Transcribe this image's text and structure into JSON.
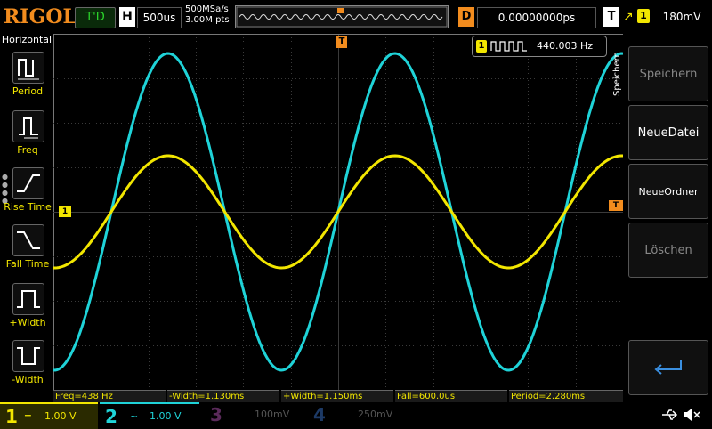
{
  "brand": "RIGOL",
  "top": {
    "run_state": "T'D",
    "timebase_label": "H",
    "timebase_value": "500us",
    "sample_rate": "500MSa/s",
    "memory_depth": "3.00M pts",
    "delay_label": "D",
    "delay_value": "0.00000000ps",
    "trigger_label": "T",
    "trigger_channel": "1",
    "trigger_level": "180mV"
  },
  "left_panel": {
    "title": "Horizontal",
    "items": [
      {
        "label": "Period",
        "icon": "period-icon"
      },
      {
        "label": "Freq",
        "icon": "freq-icon"
      },
      {
        "label": "Rise Time",
        "icon": "rise-time-icon"
      },
      {
        "label": "Fall Time",
        "icon": "fall-time-icon"
      },
      {
        "label": "+Width",
        "icon": "pos-width-icon"
      },
      {
        "label": "-Width",
        "icon": "neg-width-icon"
      }
    ]
  },
  "right_panel": {
    "tab": "Speichern",
    "buttons": [
      {
        "label": "Speichern",
        "enabled": false
      },
      {
        "label": "NeueDatei",
        "enabled": true
      },
      {
        "label": "NeueOrdner",
        "enabled": true
      },
      {
        "label": "Löschen",
        "enabled": false
      },
      {
        "label": "",
        "icon": "return-arrow-icon",
        "enabled": true
      }
    ]
  },
  "freq_counter": {
    "channel": "1",
    "value": "440.003 Hz"
  },
  "markers": {
    "trigger_position": "T",
    "ch1_ground": "1",
    "trigger_level": "T"
  },
  "measurements": [
    "Freq=438 Hz",
    "-Width=1.130ms",
    "+Width=1.150ms",
    "Fall=600.0us",
    "Period=2.280ms"
  ],
  "channels": [
    {
      "num": "1",
      "coupling": "DC",
      "scale": "1.00 V",
      "color": "#f2e600",
      "active": true
    },
    {
      "num": "2",
      "coupling": "AC",
      "scale": "1.00 V",
      "color": "#1fd3d8",
      "active": true
    },
    {
      "num": "3",
      "coupling": "",
      "scale": "100mV",
      "color": "#c060c0",
      "active": false
    },
    {
      "num": "4",
      "coupling": "",
      "scale": "250mV",
      "color": "#3a7bd5",
      "active": false
    }
  ],
  "status_icons": [
    "usb-icon",
    "speaker-muted-icon"
  ],
  "colors": {
    "accent": "#f28c1e",
    "ch1": "#f2e600",
    "ch2": "#1fd3d8",
    "grid": "#3a3a3a"
  }
}
